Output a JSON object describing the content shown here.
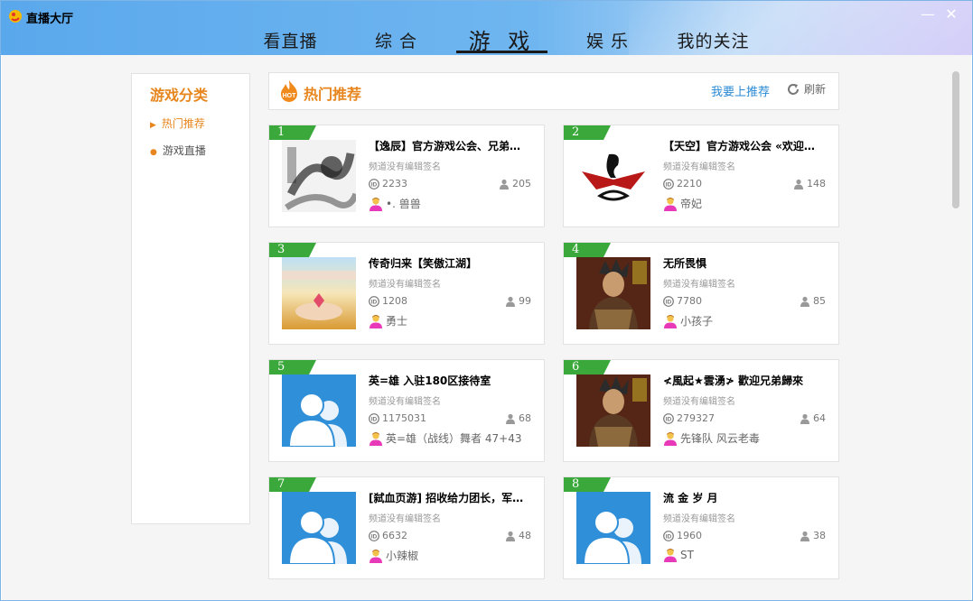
{
  "window": {
    "title": "直播大厅",
    "minimize": "—",
    "close": "✕"
  },
  "nav": {
    "items": [
      {
        "label": "看直播"
      },
      {
        "label": "综 合"
      },
      {
        "label": "游 戏"
      },
      {
        "label": "娱 乐"
      },
      {
        "label": "我的关注"
      }
    ],
    "active_index": 2
  },
  "sidebar": {
    "title": "游戏分类",
    "items": [
      {
        "label": "热门推荐",
        "active": true
      },
      {
        "label": "游戏直播",
        "active": false
      }
    ]
  },
  "section": {
    "hot_icon": "hot-flame-icon",
    "title": "热门推荐",
    "recommend_link": "我要上推荐",
    "refresh_label": "刷新"
  },
  "colors": {
    "accent": "#e7861e",
    "link": "#2a8ad4",
    "rank_badge": "#3aa83a",
    "avatar_blue": "#2f8fd8"
  },
  "channels": [
    {
      "rank": "1",
      "title": "【逸辰】官方游戏公会、兄弟…",
      "sign": "频道没有编辑签名",
      "id": "2233",
      "users": "205",
      "owner": "•. 兽兽",
      "thumb": "ink-dragon-art"
    },
    {
      "rank": "2",
      "title": "【天空】官方游戏公会 «欢迎…",
      "sign": "频道没有编辑签名",
      "id": "2210",
      "users": "148",
      "owner": "帝妃",
      "thumb": "dragon-logo"
    },
    {
      "rank": "3",
      "title": "传奇归来【笑傲江湖】",
      "sign": "频道没有编辑签名",
      "id": "1208",
      "users": "99",
      "owner": "勇士",
      "thumb": "wheat-field"
    },
    {
      "rank": "4",
      "title": "无所畏惧",
      "sign": "频道没有编辑签名",
      "id": "7780",
      "users": "85",
      "owner": "小孩子",
      "thumb": "game-warrior"
    },
    {
      "rank": "5",
      "title": "英=雄 入驻180区接待室",
      "sign": "频道没有编辑签名",
      "id": "1175031",
      "users": "68",
      "owner": "英=雄（战线）舞者 47+43",
      "thumb": "default-avatar"
    },
    {
      "rank": "6",
      "title": "≮風起★雲湧≯ 歡迎兄弟歸來",
      "sign": "频道没有编辑签名",
      "id": "279327",
      "users": "64",
      "owner": "先锋队 风云老毒",
      "thumb": "game-warrior"
    },
    {
      "rank": "7",
      "title": "[弑血页游] 招收给力团长，军…",
      "sign": "频道没有编辑签名",
      "id": "6632",
      "users": "48",
      "owner": "小辣椒",
      "thumb": "default-avatar"
    },
    {
      "rank": "8",
      "title": "流 金 岁 月",
      "sign": "频道没有编辑签名",
      "id": "1960",
      "users": "38",
      "owner": "ST",
      "thumb": "default-avatar"
    }
  ]
}
